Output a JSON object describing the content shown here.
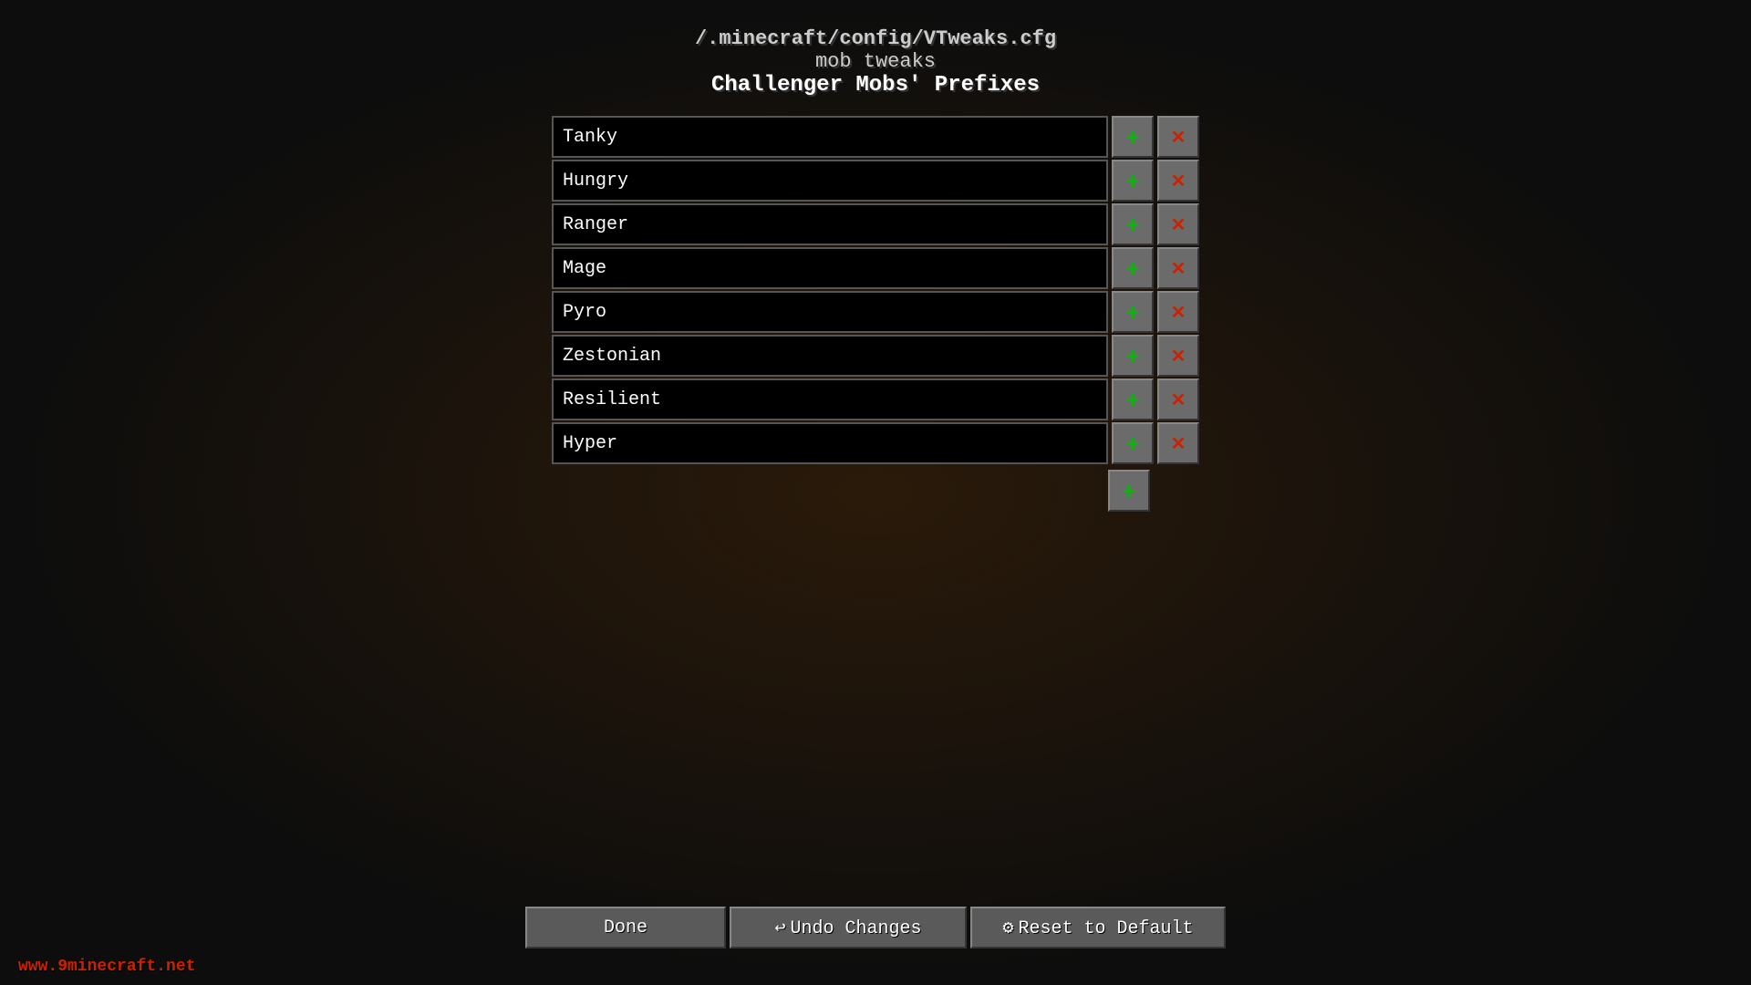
{
  "header": {
    "path": "/.minecraft/config/VTweaks.cfg",
    "section": "mob tweaks",
    "title": "Challenger Mobs' Prefixes"
  },
  "items": [
    {
      "value": "Tanky"
    },
    {
      "value": "Hungry"
    },
    {
      "value": "Ranger"
    },
    {
      "value": "Mage"
    },
    {
      "value": "Pyro"
    },
    {
      "value": "Zestonian"
    },
    {
      "value": "Resilient"
    },
    {
      "value": "Hyper"
    }
  ],
  "buttons": {
    "done": "Done",
    "undo": "↩ Undo Changes",
    "reset": "⚙ Reset to Default",
    "add_symbol": "+",
    "remove_symbol": "✕"
  },
  "watermark": "www.9minecraft.net"
}
